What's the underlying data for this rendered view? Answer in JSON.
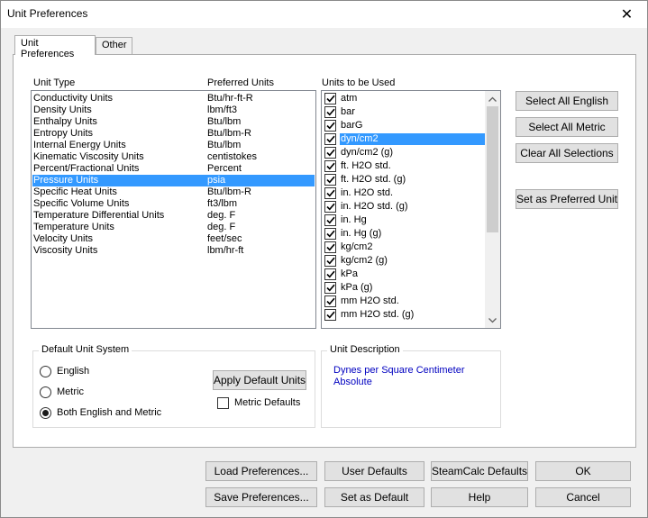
{
  "window": {
    "title": "Unit Preferences",
    "close_glyph": "✕"
  },
  "tabs": [
    {
      "label": "Unit Preferences",
      "active": true
    },
    {
      "label": "Other",
      "active": false
    }
  ],
  "unit_list": {
    "header_type": "Unit Type",
    "header_units": "Preferred Units",
    "selected_index": 7,
    "rows": [
      {
        "type": "Conductivity Units",
        "units": "Btu/hr-ft-R"
      },
      {
        "type": "Density Units",
        "units": "lbm/ft3"
      },
      {
        "type": "Enthalpy Units",
        "units": "Btu/lbm"
      },
      {
        "type": "Entropy Units",
        "units": "Btu/lbm-R"
      },
      {
        "type": "Internal Energy Units",
        "units": "Btu/lbm"
      },
      {
        "type": "Kinematic Viscosity Units",
        "units": "centistokes"
      },
      {
        "type": "Percent/Fractional Units",
        "units": "Percent"
      },
      {
        "type": "Pressure Units",
        "units": "psia"
      },
      {
        "type": "Specific Heat Units",
        "units": "Btu/lbm-R"
      },
      {
        "type": "Specific Volume Units",
        "units": "ft3/lbm"
      },
      {
        "type": "Temperature Differential Units",
        "units": "deg. F"
      },
      {
        "type": "Temperature Units",
        "units": "deg. F"
      },
      {
        "type": "Velocity Units",
        "units": "feet/sec"
      },
      {
        "type": "Viscosity Units",
        "units": "lbm/hr-ft"
      }
    ]
  },
  "units_to_use": {
    "header": "Units to be Used",
    "selected_index": 3,
    "items": [
      {
        "label": "atm",
        "checked": true
      },
      {
        "label": "bar",
        "checked": true
      },
      {
        "label": "barG",
        "checked": true
      },
      {
        "label": "dyn/cm2",
        "checked": true
      },
      {
        "label": "dyn/cm2 (g)",
        "checked": true
      },
      {
        "label": "ft. H2O std.",
        "checked": true
      },
      {
        "label": "ft. H2O std. (g)",
        "checked": true
      },
      {
        "label": "in. H2O std.",
        "checked": true
      },
      {
        "label": "in. H2O std. (g)",
        "checked": true
      },
      {
        "label": "in. Hg",
        "checked": true
      },
      {
        "label": "in. Hg (g)",
        "checked": true
      },
      {
        "label": "kg/cm2",
        "checked": true
      },
      {
        "label": "kg/cm2 (g)",
        "checked": true
      },
      {
        "label": "kPa",
        "checked": true
      },
      {
        "label": "kPa (g)",
        "checked": true
      },
      {
        "label": "mm H2O std.",
        "checked": true
      },
      {
        "label": "mm H2O std. (g)",
        "checked": true
      }
    ]
  },
  "side_buttons": {
    "select_all_english": "Select All English",
    "select_all_metric": "Select All Metric",
    "clear_all": "Clear All Selections",
    "set_preferred": "Set as Preferred Unit"
  },
  "default_unit_system": {
    "title": "Default Unit System",
    "options": [
      {
        "label": "English",
        "selected": false
      },
      {
        "label": "Metric",
        "selected": false
      },
      {
        "label": "Both English and Metric",
        "selected": true
      }
    ],
    "apply_button": "Apply Default Units",
    "metric_defaults_label": "Metric Defaults",
    "metric_defaults_checked": false
  },
  "unit_description": {
    "title": "Unit Description",
    "line1": "Dynes per Square Centimeter",
    "line2": "Absolute"
  },
  "bottom_buttons": {
    "load_preferences": "Load Preferences...",
    "user_defaults": "User Defaults",
    "steamcalc_defaults": "SteamCalc Defaults",
    "ok": "OK",
    "save_preferences": "Save Preferences...",
    "set_as_default": "Set as Default",
    "help": "Help",
    "cancel": "Cancel"
  }
}
